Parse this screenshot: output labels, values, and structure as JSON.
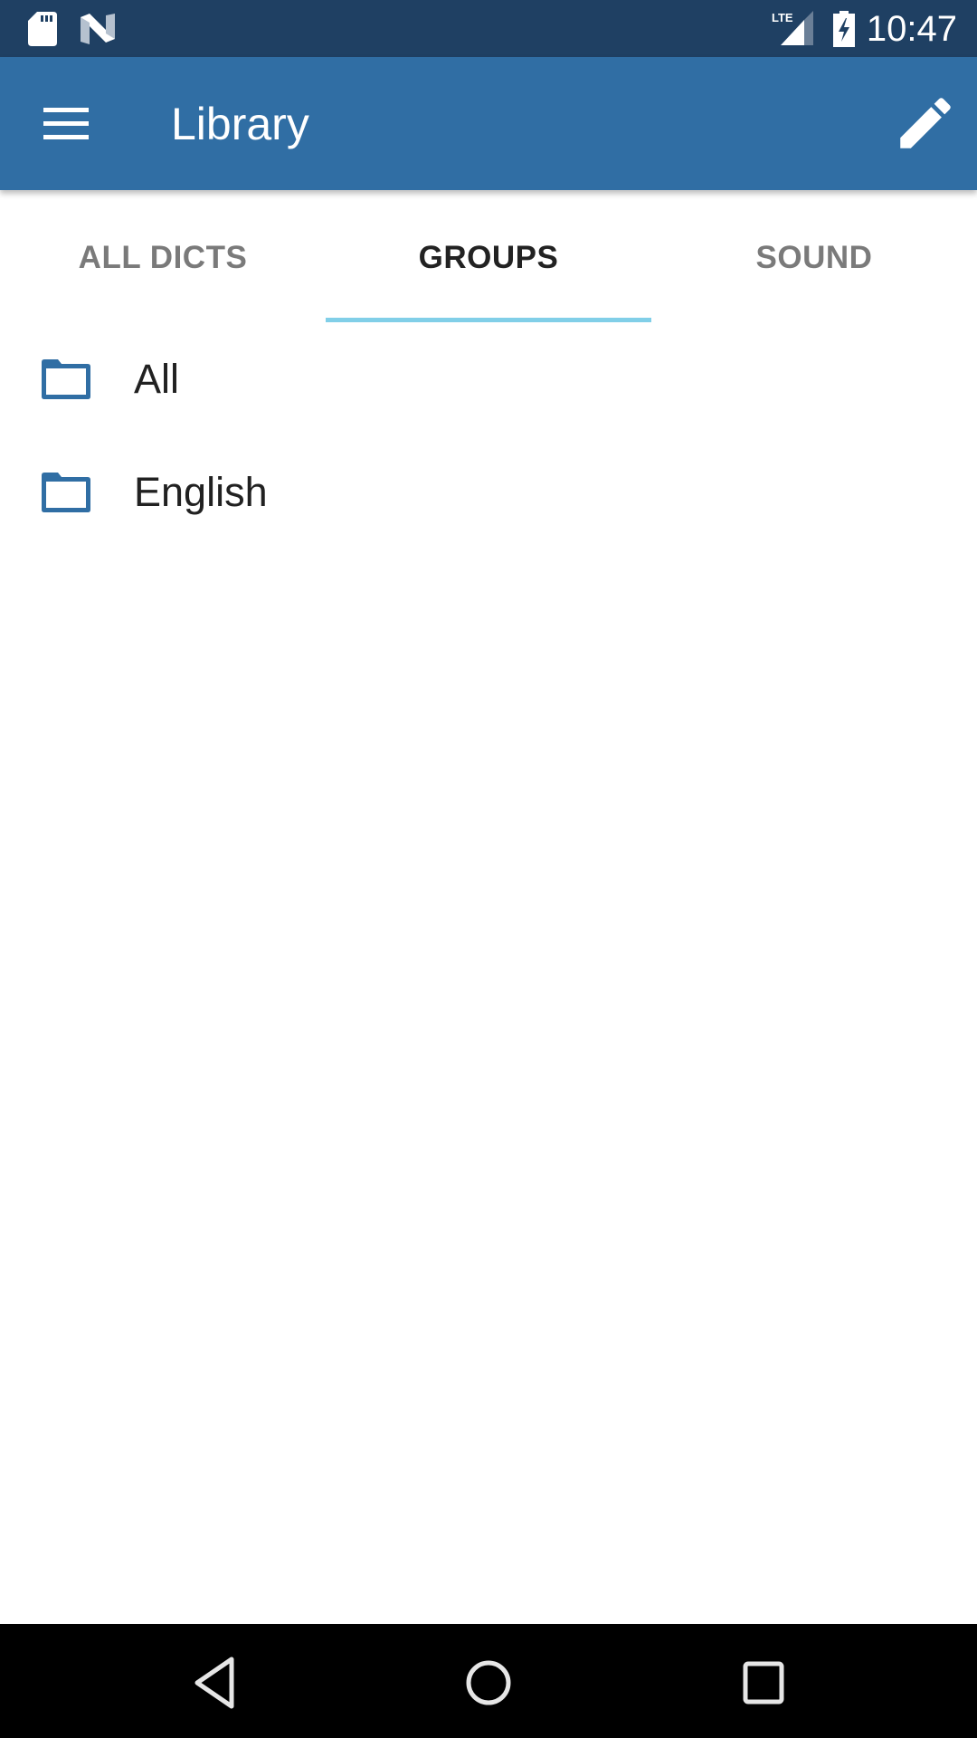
{
  "status_bar": {
    "time": "10:47",
    "left_icons": [
      "sd-card-icon",
      "n-notification-icon"
    ],
    "right_icons": [
      "lte-signal-icon",
      "battery-charging-icon"
    ],
    "network_label": "LTE"
  },
  "app_bar": {
    "title": "Library",
    "menu_icon": "hamburger-menu-icon",
    "action_icon": "pencil-edit-icon",
    "color": "#306ea4"
  },
  "tabs": [
    {
      "label": "ALL DICTS",
      "active": false
    },
    {
      "label": "GROUPS",
      "active": true
    },
    {
      "label": "SOUND",
      "active": false
    }
  ],
  "tab_indicator_color": "#81cfe8",
  "groups": [
    {
      "label": "All",
      "icon": "folder-icon"
    },
    {
      "label": "English",
      "icon": "folder-icon"
    }
  ],
  "nav_bar": {
    "buttons": [
      "back",
      "home",
      "recents"
    ]
  }
}
